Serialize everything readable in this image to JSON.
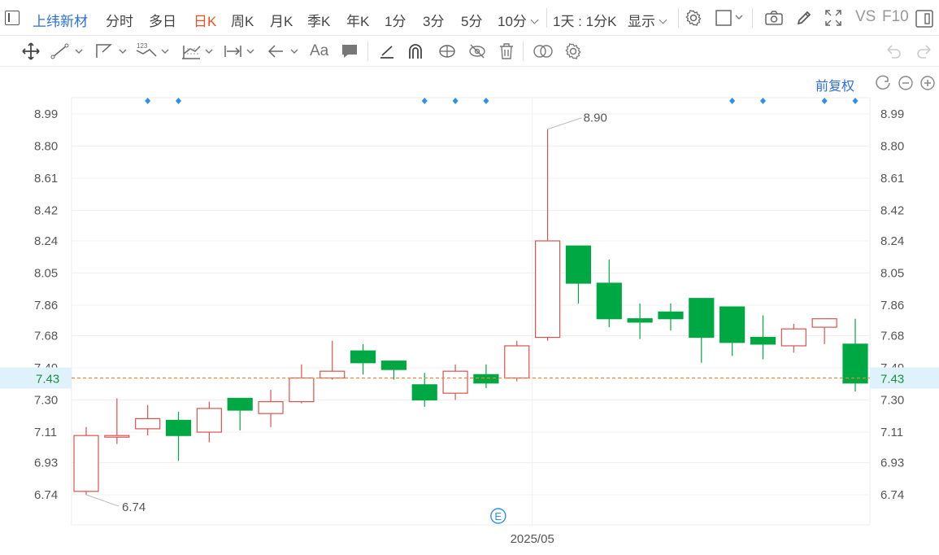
{
  "toolbar": {
    "stock_name": "上纬新材",
    "periods": [
      "分时",
      "多日",
      "日K",
      "周K",
      "月K",
      "季K",
      "年K",
      "1分",
      "3分",
      "5分"
    ],
    "active_period": "日K",
    "more_period": "10分",
    "compare": "1天 : 1分K",
    "display": "显示",
    "vs": "VS",
    "f10": "F10"
  },
  "drawbar": {
    "tools": [
      "move-icon",
      "line-icon",
      "polyline-icon",
      "wave-icon",
      "fib-icon",
      "range-icon",
      "arrow-icon",
      "text-icon",
      "comment-icon",
      "pen-icon",
      "magnet-icon",
      "link-icon",
      "hide-icon",
      "trash-icon",
      "compare-icon",
      "settings-icon"
    ],
    "text_tool": "Aa"
  },
  "chart_controls": {
    "adjust_label": "前复权"
  },
  "chart_data": {
    "type": "candlestick",
    "ylim": [
      6.65,
      9.08
    ],
    "y_ticks": [
      "8.99",
      "8.80",
      "8.61",
      "8.42",
      "8.24",
      "8.05",
      "7.86",
      "7.68",
      "7.49",
      "7.30",
      "7.11",
      "6.93",
      "6.74"
    ],
    "current_price": "7.43",
    "current_value": 7.43,
    "x_label": "2025/05",
    "high_annotation": "8.90",
    "low_annotation": "6.74",
    "event_marker": "E",
    "colors": {
      "up": "#d9534f",
      "down": "#00a844",
      "current_line": "#e8863a",
      "badge_bg": "#dff1fb"
    },
    "candles": [
      {
        "o": 6.76,
        "c": 7.09,
        "h": 7.14,
        "l": 6.74
      },
      {
        "o": 7.09,
        "c": 7.09,
        "h": 7.31,
        "l": 7.04
      },
      {
        "o": 7.13,
        "c": 7.19,
        "h": 7.27,
        "l": 7.09
      },
      {
        "o": 7.18,
        "c": 7.09,
        "h": 7.23,
        "l": 6.94
      },
      {
        "o": 7.11,
        "c": 7.25,
        "h": 7.29,
        "l": 7.05
      },
      {
        "o": 7.31,
        "c": 7.24,
        "h": 7.31,
        "l": 7.12
      },
      {
        "o": 7.22,
        "c": 7.29,
        "h": 7.36,
        "l": 7.14
      },
      {
        "o": 7.29,
        "c": 7.43,
        "h": 7.51,
        "l": 7.28
      },
      {
        "o": 7.43,
        "c": 7.47,
        "h": 7.65,
        "l": 7.42
      },
      {
        "o": 7.59,
        "c": 7.52,
        "h": 7.63,
        "l": 7.45
      },
      {
        "o": 7.53,
        "c": 7.48,
        "h": 7.53,
        "l": 7.42
      },
      {
        "o": 7.39,
        "c": 7.3,
        "h": 7.46,
        "l": 7.26
      },
      {
        "o": 7.34,
        "c": 7.47,
        "h": 7.51,
        "l": 7.3
      },
      {
        "o": 7.45,
        "c": 7.4,
        "h": 7.51,
        "l": 7.37
      },
      {
        "o": 7.43,
        "c": 7.62,
        "h": 7.65,
        "l": 7.41
      },
      {
        "o": 7.67,
        "c": 8.24,
        "h": 8.9,
        "l": 7.65
      },
      {
        "o": 8.21,
        "c": 7.99,
        "h": 8.21,
        "l": 7.87
      },
      {
        "o": 7.99,
        "c": 7.78,
        "h": 8.13,
        "l": 7.73
      },
      {
        "o": 7.78,
        "c": 7.76,
        "h": 7.87,
        "l": 7.66
      },
      {
        "o": 7.82,
        "c": 7.78,
        "h": 7.87,
        "l": 7.71
      },
      {
        "o": 7.9,
        "c": 7.67,
        "h": 7.9,
        "l": 7.52
      },
      {
        "o": 7.85,
        "c": 7.64,
        "h": 7.85,
        "l": 7.56
      },
      {
        "o": 7.67,
        "c": 7.63,
        "h": 7.8,
        "l": 7.54
      },
      {
        "o": 7.62,
        "c": 7.72,
        "h": 7.75,
        "l": 7.58
      },
      {
        "o": 7.73,
        "c": 7.78,
        "h": 7.78,
        "l": 7.63
      },
      {
        "o": 7.63,
        "c": 7.4,
        "h": 7.78,
        "l": 7.35
      }
    ],
    "top_marker_indices": [
      2,
      3,
      11,
      12,
      13,
      21,
      22,
      24,
      25
    ]
  }
}
